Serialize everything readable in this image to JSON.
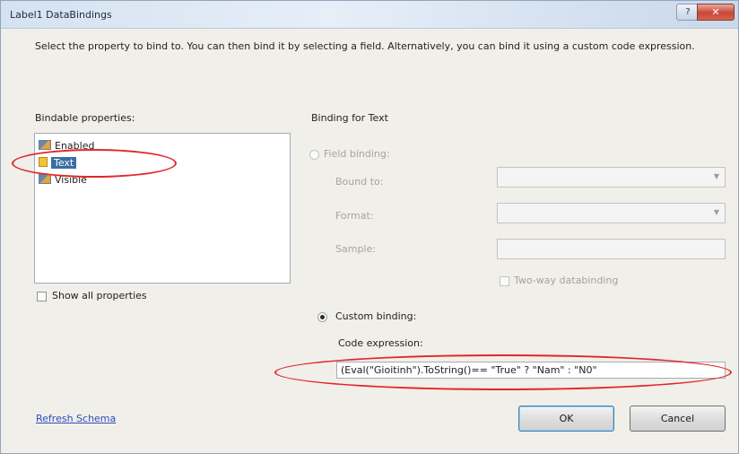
{
  "window": {
    "title": "Label1 DataBindings",
    "help_label": "?",
    "close_label": "✕"
  },
  "description": "Select the property to bind to. You can then bind it by selecting a field. Alternatively, you can bind it using a custom code expression.",
  "bindable": {
    "label": "Bindable properties:",
    "items": [
      "Enabled",
      "Text",
      "Visible"
    ],
    "selected": "Text",
    "show_all_label": "Show all properties"
  },
  "binding": {
    "heading": "Binding for Text",
    "field_binding_label": "Field binding:",
    "bound_to_label": "Bound to:",
    "format_label": "Format:",
    "sample_label": "Sample:",
    "two_way_label": "Two-way databinding",
    "custom_binding_label": "Custom binding:",
    "code_expression_label": "Code expression:",
    "code_expression_value": "(Eval(\"Gioitinh\").ToString()== \"True\" ? \"Nam\" : \"N0\""
  },
  "footer": {
    "refresh_label": "Refresh Schema",
    "ok_label": "OK",
    "cancel_label": "Cancel"
  },
  "colors": {
    "annotation": "#e0282a",
    "selection": "#3a6ea5",
    "link": "#2a4fbf"
  }
}
